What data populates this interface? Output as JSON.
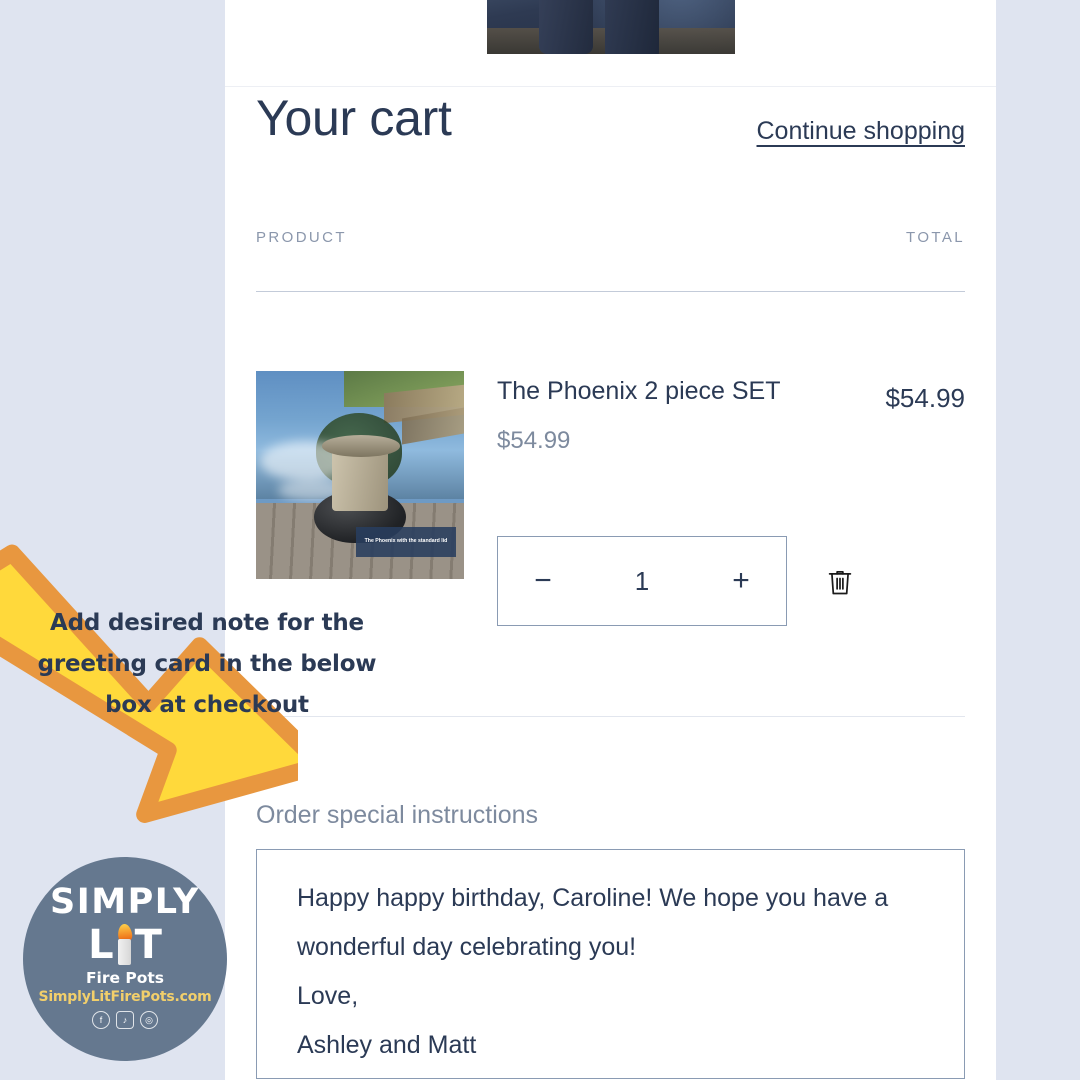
{
  "page": {
    "background_color": "#dfe4f0",
    "card_background": "#ffffff",
    "accent_text_color": "#2b3a55",
    "muted_text_color": "#7d8a9e"
  },
  "banner": {
    "socials": [
      {
        "name": "facebook-icon",
        "glyph": "f",
        "shape": "circ"
      },
      {
        "name": "tiktok-icon",
        "glyph": "♪",
        "shape": "sq"
      },
      {
        "name": "instagram-icon",
        "glyph": "◎",
        "shape": "circ"
      }
    ]
  },
  "header": {
    "title": "Your cart",
    "continue_shopping": "Continue shopping"
  },
  "table": {
    "col_product": "PRODUCT",
    "col_total": "TOTAL"
  },
  "line_item": {
    "title": "The Phoenix 2 piece SET",
    "unit_price": "$54.99",
    "line_total": "$54.99",
    "quantity": "1",
    "decrease_label": "−",
    "increase_label": "+",
    "remove_label": "trash-icon",
    "thumbnail_caption": "The Phoenix with the standard lid"
  },
  "instructions": {
    "label": "Order special instructions",
    "value": "Happy happy birthday, Caroline! We hope you have a wonderful day celebrating you!\nLove,\nAshley and Matt",
    "placeholder": ""
  },
  "annotation": {
    "text": "Add desired note for the greeting card in the below box at checkout",
    "arrow_fill": "#ffd93b",
    "arrow_stroke": "#e8973f"
  },
  "brand": {
    "name_top": "SIMPLY",
    "name_l": "L",
    "name_t": "T",
    "tagline": "Fire Pots",
    "website": "SimplyLitFirePots.com",
    "badge_color": "#65788f",
    "url_color": "#f2cf6b",
    "socials": [
      {
        "name": "facebook-icon",
        "glyph": "f",
        "shape": "circ"
      },
      {
        "name": "tiktok-icon",
        "glyph": "♪",
        "shape": "sq"
      },
      {
        "name": "instagram-icon",
        "glyph": "◎",
        "shape": "circ"
      }
    ]
  }
}
